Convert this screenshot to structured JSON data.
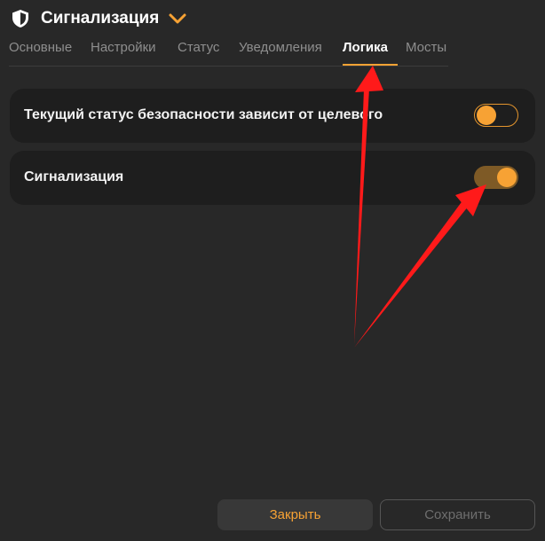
{
  "header": {
    "title": "Сигнализация",
    "icon": "shield-icon",
    "dropdown_icon": "chevron-down-icon"
  },
  "tabs": [
    {
      "label": "Основные",
      "active": false
    },
    {
      "label": "Настройки",
      "active": false
    },
    {
      "label": "Статус",
      "active": false
    },
    {
      "label": "Уведомления",
      "active": false
    },
    {
      "label": "Логика",
      "active": true
    },
    {
      "label": "Мосты",
      "active": false
    }
  ],
  "settings": [
    {
      "label": "Текущий статус безопасности зависит от целевого",
      "enabled": false
    },
    {
      "label": "Сигнализация",
      "enabled": true
    }
  ],
  "footer": {
    "close_label": "Закрыть",
    "save_label": "Сохранить"
  },
  "colors": {
    "accent": "#f7a234",
    "background": "#282828",
    "card": "#1e1e1e",
    "annotation_arrow": "#ff1a1a"
  }
}
